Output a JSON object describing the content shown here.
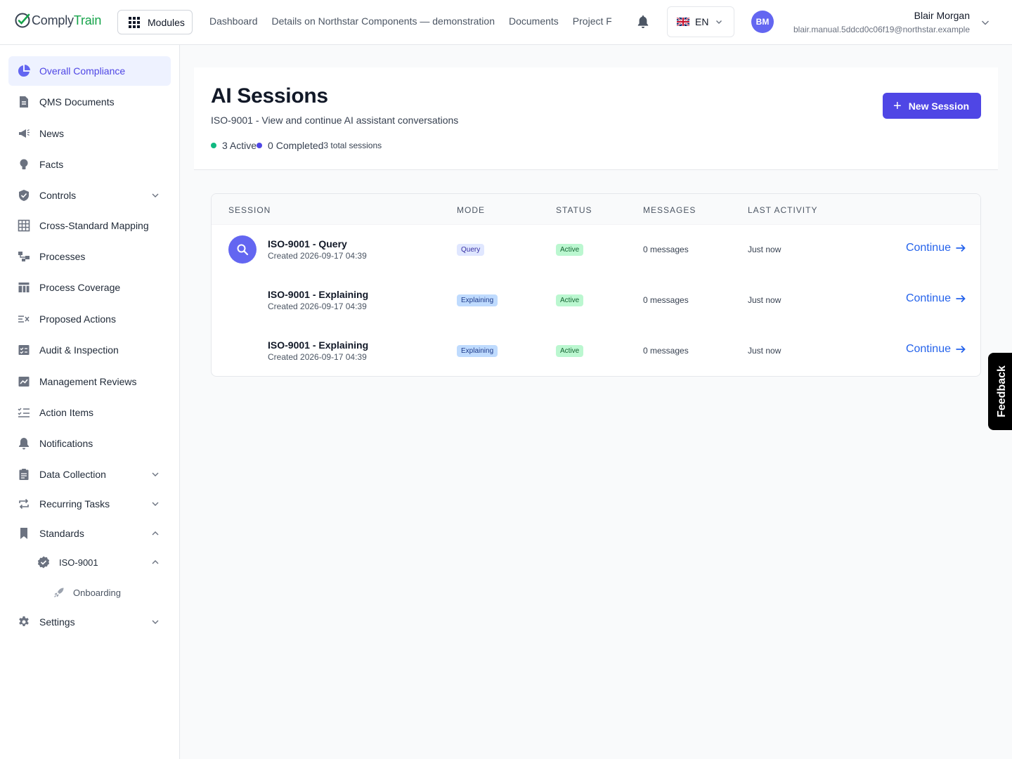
{
  "brand": {
    "part1": "Comply",
    "part2": "Train",
    "brand_color": "#16a34a"
  },
  "topbar": {
    "modules_label": "Modules",
    "nav": [
      "Dashboard",
      "Details on Northstar Components — demonstration",
      "Documents",
      "Project F"
    ],
    "language": "EN",
    "user": {
      "initials": "BM",
      "name": "Blair Morgan",
      "email": "blair.manual.5ddcd0c06f19@northstar.example"
    }
  },
  "sidebar": {
    "items": [
      {
        "label": "Overall Compliance",
        "icon": "pie-chart-icon",
        "active": true
      },
      {
        "label": "QMS Documents",
        "icon": "document-icon"
      },
      {
        "label": "News",
        "icon": "megaphone-icon"
      },
      {
        "label": "Facts",
        "icon": "lightbulb-icon"
      },
      {
        "label": "Controls",
        "icon": "shield-icon",
        "expandable": true
      },
      {
        "label": "Cross-Standard Mapping",
        "icon": "table-grid-icon"
      },
      {
        "label": "Processes",
        "icon": "process-icon"
      },
      {
        "label": "Process Coverage",
        "icon": "coverage-table-icon"
      },
      {
        "label": "Proposed Actions",
        "icon": "list-x-icon"
      },
      {
        "label": "Audit & Inspection",
        "icon": "checklist-icon"
      },
      {
        "label": "Management Reviews",
        "icon": "chart-line-icon"
      },
      {
        "label": "Action Items",
        "icon": "check-list-icon"
      },
      {
        "label": "Notifications",
        "icon": "bell-icon"
      },
      {
        "label": "Data Collection",
        "icon": "clipboard-icon",
        "expandable": true
      },
      {
        "label": "Recurring Tasks",
        "icon": "repeat-icon",
        "expandable": true
      },
      {
        "label": "Standards",
        "icon": "bookmark-icon",
        "expanded": true
      }
    ],
    "standard": {
      "label": "ISO-9001",
      "icon": "badge-check-icon"
    },
    "standard_child": {
      "label": "Onboarding",
      "icon": "rocket-icon"
    },
    "settings": {
      "label": "Settings",
      "icon": "gear-icon"
    }
  },
  "page": {
    "title": "AI Sessions",
    "subtitle": "ISO-9001 - View and continue AI assistant conversations",
    "stats": {
      "active": "3 Active",
      "completed": "0 Completed",
      "total": "3 total sessions",
      "active_color": "#10b981",
      "completed_color": "#4f46e5"
    },
    "new_button": "New Session"
  },
  "table": {
    "headers": [
      "Session",
      "Mode",
      "Status",
      "Messages",
      "Last Activity"
    ],
    "rows": [
      {
        "title": "ISO-9001 - Query",
        "created": "Created 2026-09-17 04:39",
        "mode": "Query",
        "status": "Active",
        "messages": "0 messages",
        "last_activity": "Just now",
        "action": "Continue",
        "icon": "search-icon"
      },
      {
        "title": "ISO-9001 - Explaining",
        "created": "Created 2026-09-17 04:39",
        "mode": "Explaining",
        "status": "Active",
        "messages": "0 messages",
        "last_activity": "Just now",
        "action": "Continue"
      },
      {
        "title": "ISO-9001 - Explaining",
        "created": "Created 2026-09-17 04:39",
        "mode": "Explaining",
        "status": "Active",
        "messages": "0 messages",
        "last_activity": "Just now",
        "action": "Continue"
      }
    ]
  },
  "feedback_label": "Feedback"
}
